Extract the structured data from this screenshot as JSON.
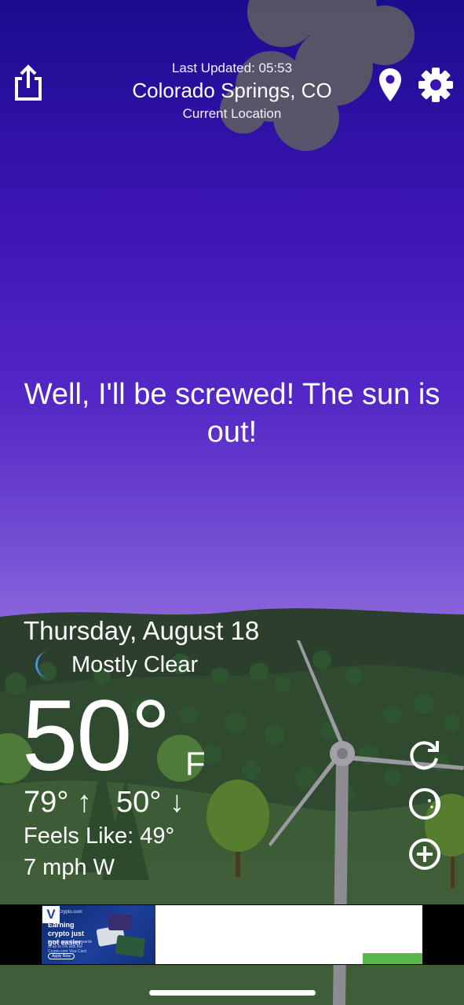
{
  "header": {
    "last_updated": "Last Updated: 05:53",
    "city": "Colorado Springs, CO",
    "location_note": "Current Location"
  },
  "message": "Well, I'll be screwed! The sun is out!",
  "weather": {
    "date": "Thursday, August 18",
    "condition": "Mostly Clear",
    "condition_icon": "crescent-moon-icon",
    "temperature": "50°",
    "unit": "F",
    "high": "79° ↑",
    "low": "50° ↓",
    "feels_like": "Feels Like: 49°",
    "wind": "7 mph W"
  },
  "actions": {
    "share_icon": "share-icon",
    "location_icon": "location-pin-icon",
    "settings_icon": "gear-icon",
    "refresh_icon": "refresh-icon",
    "theme_icon": "theme-icon",
    "add_icon": "add-circle-icon"
  },
  "ad": {
    "domain": "Crypto.com",
    "headline": "Earning crypto just got easier.",
    "subtext": "Unlock spending rewards of up to 5% with the Crypto.com Visa Card.",
    "cta": "Apply Now"
  },
  "colors": {
    "sky_top": "#1a0c8e",
    "sky_bottom": "#c6a4f7",
    "hills_dark": "#243a26",
    "grass": "#3a5a34",
    "moon": "#4b8ff0",
    "ad_green": "#58b74d"
  }
}
